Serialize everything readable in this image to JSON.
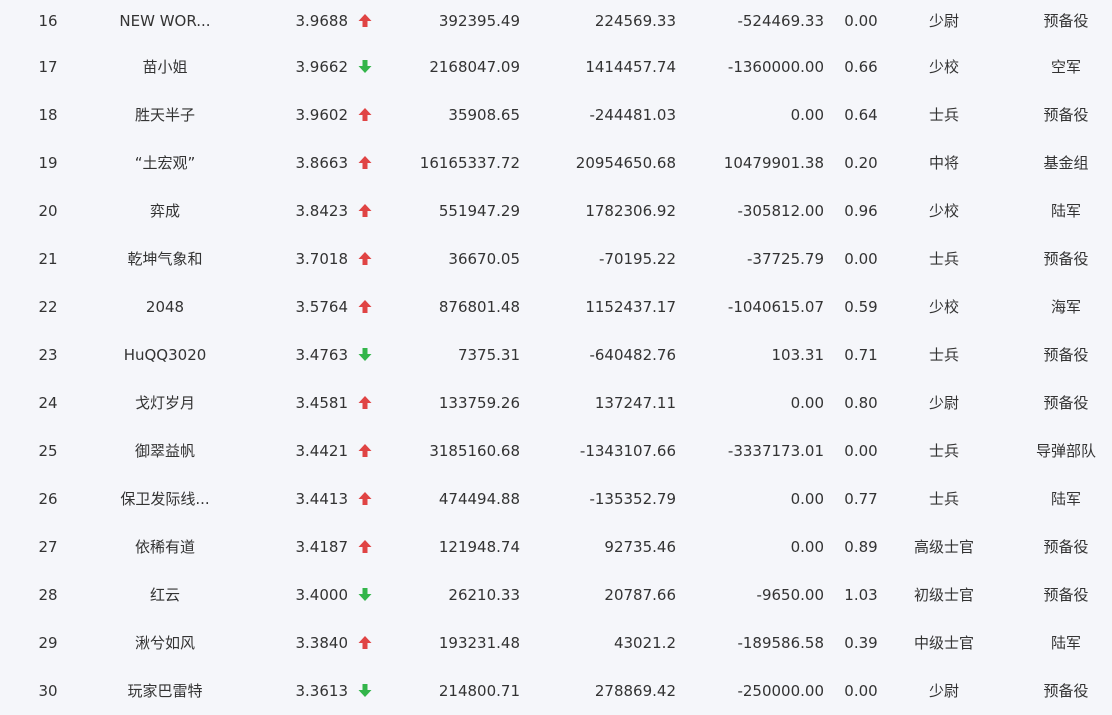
{
  "colors": {
    "up": "#e04444",
    "down": "#33b54a",
    "text": "#333333",
    "background": "#f5f6fa"
  },
  "rows": [
    {
      "rank": "16",
      "name": "NEW WOR...",
      "score": "3.9688",
      "trend": "up",
      "v1": "392395.49",
      "v2": "224569.33",
      "v3": "-524469.33",
      "ratio": "0.00",
      "title": "少尉",
      "branch": "预备役"
    },
    {
      "rank": "17",
      "name": "苗小姐",
      "score": "3.9662",
      "trend": "down",
      "v1": "2168047.09",
      "v2": "1414457.74",
      "v3": "-1360000.00",
      "ratio": "0.66",
      "title": "少校",
      "branch": "空军"
    },
    {
      "rank": "18",
      "name": "胜天半子",
      "score": "3.9602",
      "trend": "up",
      "v1": "35908.65",
      "v2": "-244481.03",
      "v3": "0.00",
      "ratio": "0.64",
      "title": "士兵",
      "branch": "预备役"
    },
    {
      "rank": "19",
      "name": "“土宏观”",
      "score": "3.8663",
      "trend": "up",
      "v1": "16165337.72",
      "v2": "20954650.68",
      "v3": "10479901.38",
      "ratio": "0.20",
      "title": "中将",
      "branch": "基金组"
    },
    {
      "rank": "20",
      "name": "弈成",
      "score": "3.8423",
      "trend": "up",
      "v1": "551947.29",
      "v2": "1782306.92",
      "v3": "-305812.00",
      "ratio": "0.96",
      "title": "少校",
      "branch": "陆军"
    },
    {
      "rank": "21",
      "name": "乾坤气象和",
      "score": "3.7018",
      "trend": "up",
      "v1": "36670.05",
      "v2": "-70195.22",
      "v3": "-37725.79",
      "ratio": "0.00",
      "title": "士兵",
      "branch": "预备役"
    },
    {
      "rank": "22",
      "name": "2048",
      "score": "3.5764",
      "trend": "up",
      "v1": "876801.48",
      "v2": "1152437.17",
      "v3": "-1040615.07",
      "ratio": "0.59",
      "title": "少校",
      "branch": "海军"
    },
    {
      "rank": "23",
      "name": "HuQQ3020",
      "score": "3.4763",
      "trend": "down",
      "v1": "7375.31",
      "v2": "-640482.76",
      "v3": "103.31",
      "ratio": "0.71",
      "title": "士兵",
      "branch": "预备役"
    },
    {
      "rank": "24",
      "name": "戈灯岁月",
      "score": "3.4581",
      "trend": "up",
      "v1": "133759.26",
      "v2": "137247.11",
      "v3": "0.00",
      "ratio": "0.80",
      "title": "少尉",
      "branch": "预备役"
    },
    {
      "rank": "25",
      "name": "御翠益帆",
      "score": "3.4421",
      "trend": "up",
      "v1": "3185160.68",
      "v2": "-1343107.66",
      "v3": "-3337173.01",
      "ratio": "0.00",
      "title": "士兵",
      "branch": "导弹部队"
    },
    {
      "rank": "26",
      "name": "保卫发际线...",
      "score": "3.4413",
      "trend": "up",
      "v1": "474494.88",
      "v2": "-135352.79",
      "v3": "0.00",
      "ratio": "0.77",
      "title": "士兵",
      "branch": "陆军"
    },
    {
      "rank": "27",
      "name": "依稀有道",
      "score": "3.4187",
      "trend": "up",
      "v1": "121948.74",
      "v2": "92735.46",
      "v3": "0.00",
      "ratio": "0.89",
      "title": "高级士官",
      "branch": "预备役"
    },
    {
      "rank": "28",
      "name": "红云",
      "score": "3.4000",
      "trend": "down",
      "v1": "26210.33",
      "v2": "20787.66",
      "v3": "-9650.00",
      "ratio": "1.03",
      "title": "初级士官",
      "branch": "预备役"
    },
    {
      "rank": "29",
      "name": "湫兮如风",
      "score": "3.3840",
      "trend": "up",
      "v1": "193231.48",
      "v2": "43021.2",
      "v3": "-189586.58",
      "ratio": "0.39",
      "title": "中级士官",
      "branch": "陆军"
    },
    {
      "rank": "30",
      "name": "玩家巴雷特",
      "score": "3.3613",
      "trend": "down",
      "v1": "214800.71",
      "v2": "278869.42",
      "v3": "-250000.00",
      "ratio": "0.00",
      "title": "少尉",
      "branch": "预备役"
    }
  ]
}
